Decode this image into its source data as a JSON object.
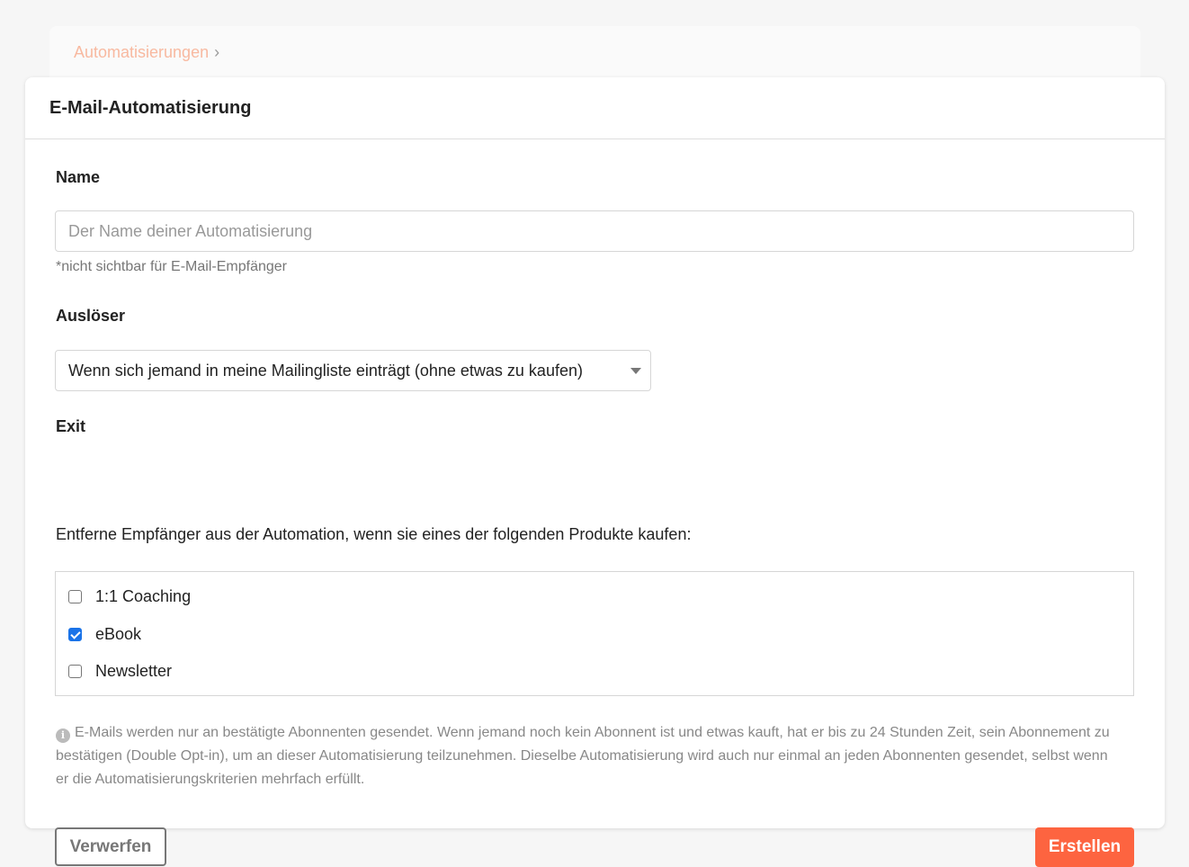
{
  "breadcrumb": {
    "link": "Automatisierungen",
    "separator": "›"
  },
  "modal": {
    "title": "E-Mail-Automatisierung",
    "name": {
      "label": "Name",
      "placeholder": "Der Name deiner Automatisierung",
      "value": "",
      "hint": "*nicht sichtbar für E-Mail-Empfänger"
    },
    "trigger": {
      "label": "Auslöser",
      "selected": "Wenn sich jemand in meine Mailingliste einträgt (ohne etwas zu kaufen)"
    },
    "exit": {
      "label": "Exit",
      "description": "Entferne Empfänger aus der Automation, wenn sie eines der folgenden Produkte kaufen:",
      "products": [
        {
          "label": "1:1 Coaching",
          "checked": false
        },
        {
          "label": "eBook",
          "checked": true
        },
        {
          "label": "Newsletter",
          "checked": false
        }
      ]
    },
    "info_icon": "info-circle-icon",
    "info_text": "E-Mails werden nur an bestätigte Abonnenten gesendet. Wenn jemand noch kein Abonnent ist und etwas kauft, hat er bis zu 24 Stunden Zeit, sein Abonnement zu bestätigen (Double Opt-in), um an dieser Automatisierung teilzunehmen. Dieselbe Automatisierung wird auch nur einmal an jeden Abonnenten gesendet, selbst wenn er die Automatisierungskriterien mehrfach erfüllt.",
    "buttons": {
      "discard": "Verwerfen",
      "create": "Erstellen"
    }
  },
  "colors": {
    "accent": "#fd6440",
    "breadcrumb_link": "#f8b9a0",
    "checkbox_checked": "#1a73e8"
  }
}
